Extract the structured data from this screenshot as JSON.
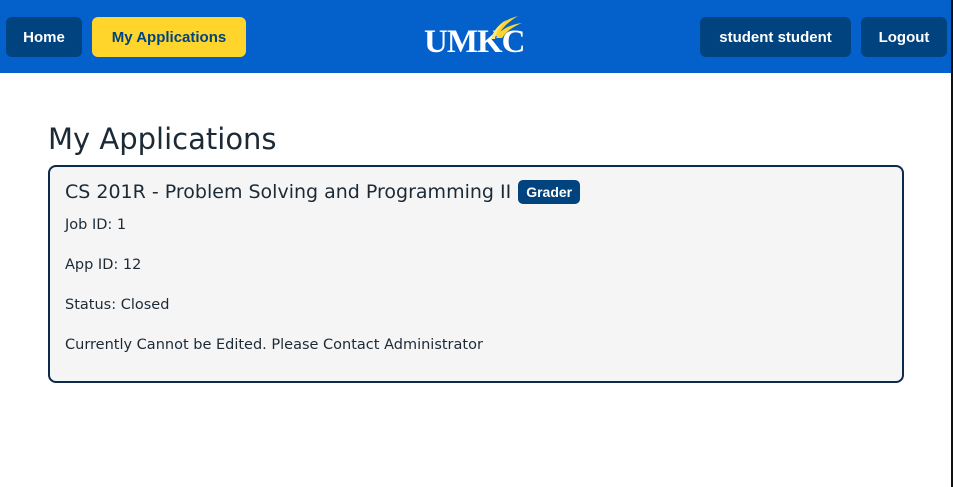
{
  "nav": {
    "home_label": "Home",
    "my_applications_label": "My Applications",
    "user_label": "student student",
    "logout_label": "Logout",
    "logo_text": "UMKC"
  },
  "colors": {
    "nav_bg": "#0461cc",
    "button_dark": "#00437f",
    "button_active": "#ffd52c",
    "card_border": "#0c2a4a",
    "card_bg": "#f5f5f5"
  },
  "main": {
    "title": "My Applications",
    "applications": [
      {
        "course": "CS 201R - Problem Solving and Programming II",
        "role": "Grader",
        "job_id_text": "Job ID: 1",
        "app_id_text": "App ID: 12",
        "status_text": "Status: Closed",
        "notice": "Currently Cannot be Edited. Please Contact Administrator"
      }
    ]
  }
}
